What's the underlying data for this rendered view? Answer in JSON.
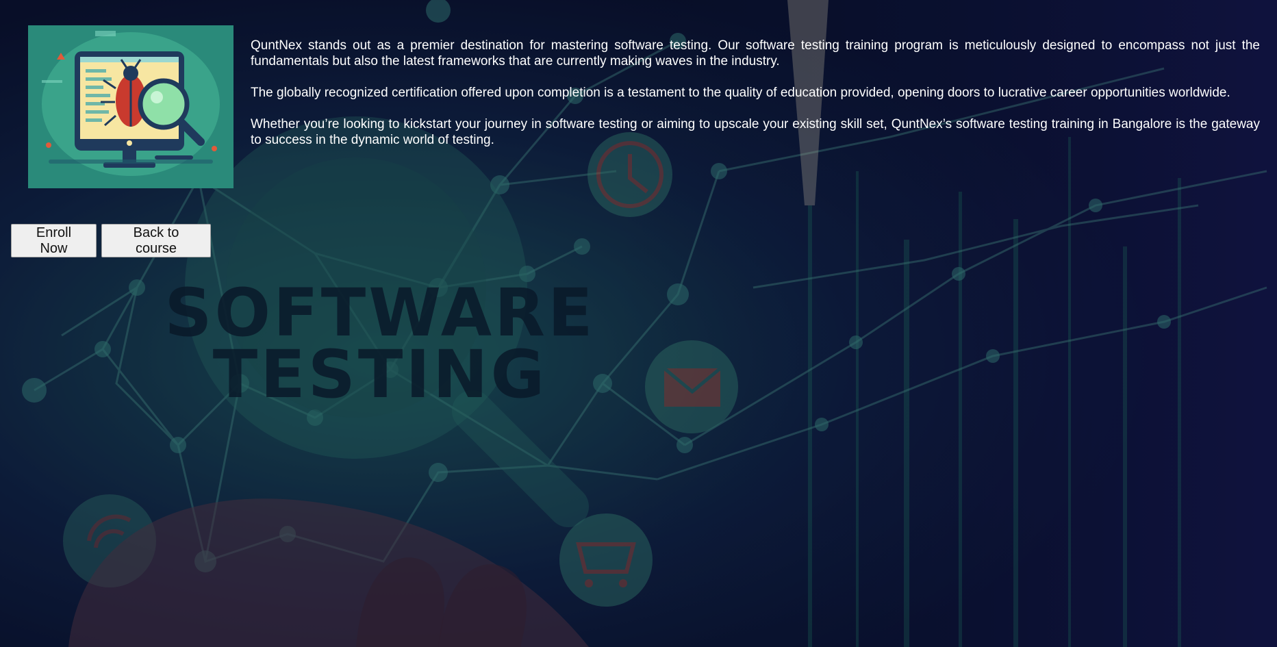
{
  "paragraphs": [
    "QuntNex stands out as a premier destination for mastering software testing. Our software testing training program is meticulously designed to encompass not just the fundamentals but also the latest frameworks that are currently making waves in the industry.",
    "The globally recognized certification offered upon completion is a testament to the quality of education provided, opening doors to lucrative career opportunities worldwide.",
    "Whether you’re looking to kickstart your journey in software testing or aiming to upscale your existing skill set, QuntNex’s software testing training in Bangalore is the gateway to success in the dynamic world of testing."
  ],
  "buttons": {
    "enroll": "Enroll Now",
    "back": "Back to course"
  },
  "background_text": {
    "line1": "SOFTWARE",
    "line2": "TESTING"
  },
  "colors": {
    "page_bg": "#0a1530",
    "thumb_bg": "#2a8a7a",
    "text": "#ffffff"
  },
  "icons": [
    "bug-icon",
    "magnifier-icon",
    "monitor-icon",
    "clock-icon",
    "mail-icon",
    "cart-icon",
    "wifi-icon"
  ]
}
